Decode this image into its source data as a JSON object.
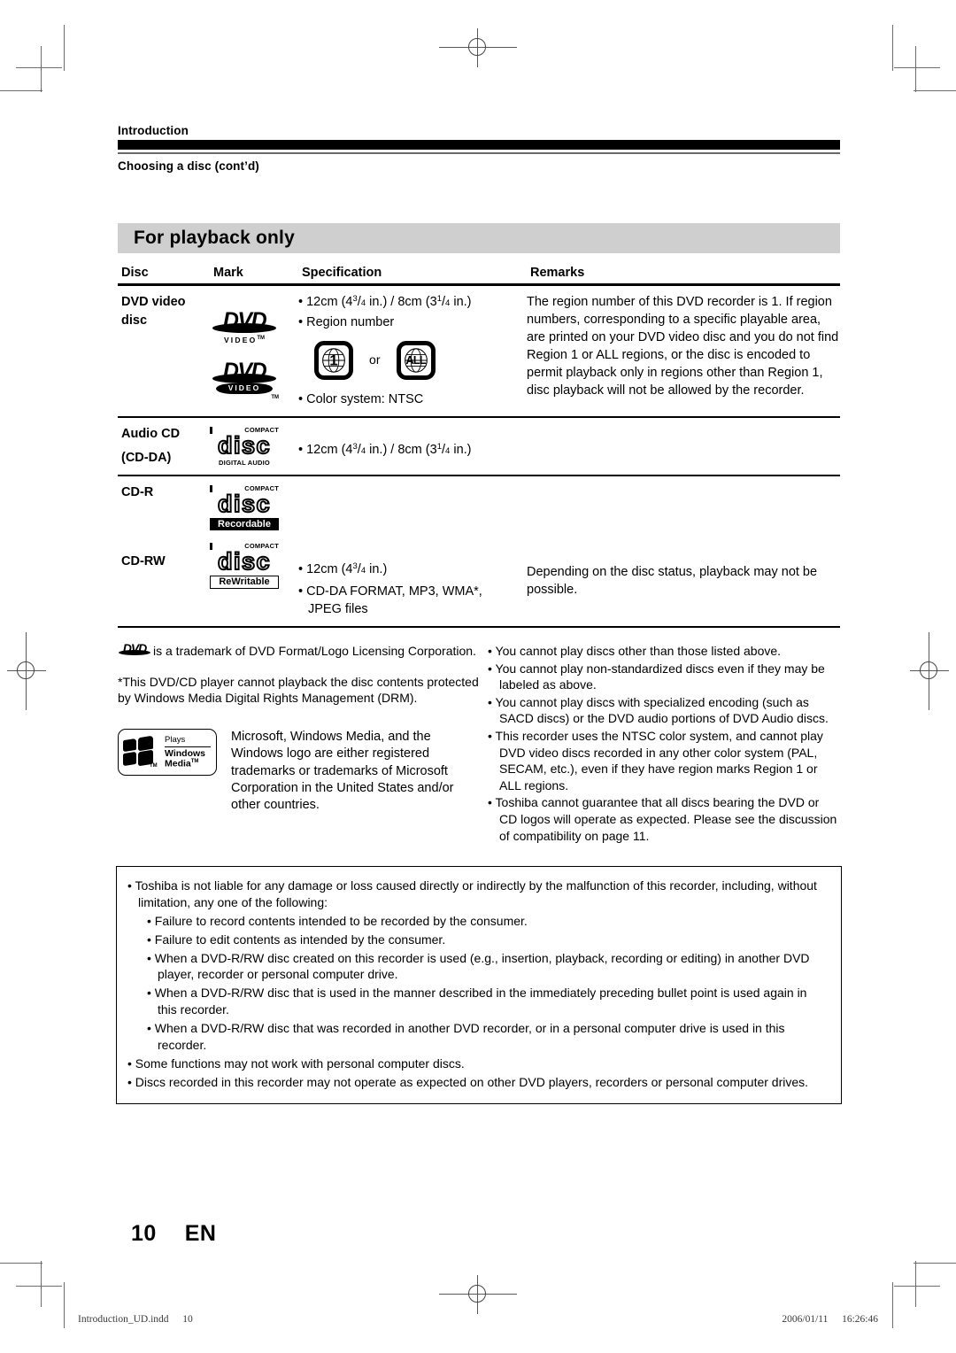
{
  "header": {
    "section": "Introduction",
    "subtitle": "Choosing a disc (cont’d)"
  },
  "section_title": "For playback only",
  "table": {
    "columns": [
      "Disc",
      "Mark",
      "Specification",
      "Remarks"
    ],
    "rows": [
      {
        "disc": [
          "DVD video",
          "disc"
        ],
        "marks": [
          "dvd-video-logo",
          "dvd-video-logo-inverse"
        ],
        "spec": [
          "• 12cm (4 3/4 in.) / 8cm (3 1/4 in.)",
          "• Region number",
          "• Color system: NTSC"
        ],
        "region_marks": {
          "first": "1",
          "connector": "or",
          "second": "ALL"
        },
        "remarks": "The region number of this DVD recorder is 1. If region numbers, corresponding to a specific playable area, are printed on your DVD video disc and you do not find Region 1 or ALL regions, or the disc is encoded to permit playback only in regions other than Region 1, disc playback will not be allowed by the recorder."
      },
      {
        "disc": [
          "Audio CD",
          "(CD-DA)"
        ],
        "marks": [
          "compact-disc-digital-audio-logo"
        ],
        "spec": [
          "• 12cm (4 3/4 in.) / 8cm (3 1/4 in.)"
        ],
        "remarks": ""
      },
      {
        "disc": [
          "CD-R",
          "CD-RW"
        ],
        "marks": [
          "compact-disc-recordable-logo",
          "compact-disc-rewritable-logo"
        ],
        "spec": [
          "• 12cm (4 3/4 in.)",
          "• CD-DA FORMAT, MP3, WMA*,",
          "JPEG files"
        ],
        "remarks": "Depending on the disc status, playback may not be possible."
      }
    ]
  },
  "logos": {
    "dvd_word": "DVD",
    "dvd_video": "VIDEO",
    "cd_compact": "COMPACT",
    "cd_disc": "disc",
    "cd_digital_audio": "DIGITAL AUDIO",
    "cd_recordable": "Recordable",
    "cd_rewritable": "ReWritable",
    "wm_plays": "Plays",
    "wm_windows": "Windows",
    "wm_media": "Media",
    "tm": "TM"
  },
  "notes": {
    "trademark_line": "is a trademark of DVD Format/Logo Licensing Corporation.",
    "drm_note": "*This DVD/CD player cannot playback the disc contents protected by Windows Media Digital Rights Management (DRM).",
    "microsoft_note": "Microsoft, Windows Media, and the Windows logo are either registered trademarks or trademarks of Microsoft Corporation in the United States and/or other countries.",
    "right_bullets": [
      "You cannot play discs other than those listed above.",
      "You cannot play non-standardized discs even if they may be labeled as above.",
      "You cannot play discs with specialized encoding (such as SACD discs) or the DVD audio portions of DVD Audio discs.",
      "This recorder uses the NTSC color system, and cannot play DVD video discs recorded in any other color system (PAL, SECAM, etc.), even if they have region marks Region 1 or ALL regions.",
      "Toshiba cannot guarantee that all discs bearing the DVD or CD logos will operate as expected. Please see the discussion of compatibility on page 11."
    ]
  },
  "liability_box": {
    "lead": "Toshiba is not liable for any damage or loss caused directly or indirectly by the malfunction of this recorder, including, without limitation, any one of the following:",
    "sub_items": [
      "Failure to record contents intended to be recorded by the consumer.",
      "Failure to edit contents as intended by the consumer.",
      "When a DVD-R/RW disc created on this recorder is used (e.g., insertion, playback, recording or editing) in another DVD player, recorder or personal computer drive.",
      "When a DVD-R/RW disc that is used in the manner described in the immediately preceding bullet point is used again in this recorder.",
      "When a DVD-R/RW disc that was recorded in another DVD recorder, or in a personal computer drive is used in this recorder."
    ],
    "tail_items": [
      "Some functions may not work with personal computer discs.",
      "Discs recorded in this recorder may not operate as expected on other DVD players, recorders or personal computer drives."
    ]
  },
  "page_number": {
    "number": "10",
    "lang": "EN"
  },
  "footer": {
    "file": "Introduction_UD.indd",
    "page": "10",
    "date": "2006/01/11",
    "time": "16:26:46"
  }
}
